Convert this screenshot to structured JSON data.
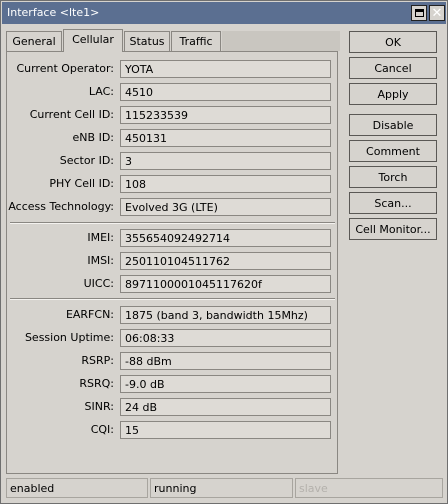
{
  "window": {
    "title": "Interface <lte1>"
  },
  "tabs": [
    {
      "label": "General"
    },
    {
      "label": "Cellular"
    },
    {
      "label": "Status"
    },
    {
      "label": "Traffic"
    }
  ],
  "fields": {
    "current_operator": {
      "label": "Current Operator:",
      "value": "YOTA"
    },
    "lac": {
      "label": "LAC:",
      "value": "4510"
    },
    "current_cell_id": {
      "label": "Current Cell ID:",
      "value": "115233539"
    },
    "enb_id": {
      "label": "eNB ID:",
      "value": "450131"
    },
    "sector_id": {
      "label": "Sector ID:",
      "value": "3"
    },
    "phy_cell_id": {
      "label": "PHY Cell ID:",
      "value": "108"
    },
    "access_technology": {
      "label": "Access Technology:",
      "value": "Evolved 3G (LTE)"
    },
    "imei": {
      "label": "IMEI:",
      "value": "355654092492714"
    },
    "imsi": {
      "label": "IMSI:",
      "value": "250110104511762"
    },
    "uicc": {
      "label": "UICC:",
      "value": "8971100001045117620f"
    },
    "earfcn": {
      "label": "EARFCN:",
      "value": "1875 (band 3, bandwidth 15Mhz)"
    },
    "session_uptime": {
      "label": "Session Uptime:",
      "value": "06:08:33"
    },
    "rsrp": {
      "label": "RSRP:",
      "value": "-88 dBm"
    },
    "rsrq": {
      "label": "RSRQ:",
      "value": "-9.0 dB"
    },
    "sinr": {
      "label": "SINR:",
      "value": "24 dB"
    },
    "cqi": {
      "label": "CQI:",
      "value": "15"
    }
  },
  "buttons": {
    "ok": "OK",
    "cancel": "Cancel",
    "apply": "Apply",
    "disable": "Disable",
    "comment": "Comment",
    "torch": "Torch",
    "scan": "Scan...",
    "cell_monitor": "Cell Monitor..."
  },
  "statusbar": {
    "state": "enabled",
    "run_state": "running",
    "slave": "slave"
  }
}
